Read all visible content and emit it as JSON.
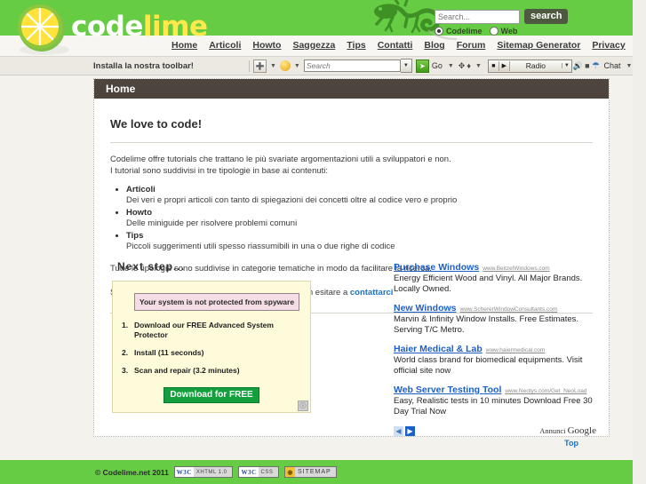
{
  "brand": {
    "code": "code",
    "lime": "lime"
  },
  "search": {
    "placeholder": "Search...",
    "value": "",
    "button": "search",
    "scope_site": "Codelime",
    "scope_web": "Web"
  },
  "nav": {
    "items": [
      {
        "label": "Home"
      },
      {
        "label": "Articoli"
      },
      {
        "label": "Howto"
      },
      {
        "label": "Saggezza"
      },
      {
        "label": "Tips"
      },
      {
        "label": "Contatti"
      },
      {
        "label": "Blog"
      },
      {
        "label": "Forum"
      },
      {
        "label": "Sitemap Generator"
      },
      {
        "label": "Privacy"
      }
    ]
  },
  "toolbar": {
    "label": "Installa la nostra toolbar!",
    "search_placeholder": "Search",
    "go_label": "Go",
    "radio_label": "Radio",
    "chat_label": "Chat"
  },
  "card": {
    "header": "Home",
    "title": "We love to code!",
    "intro_line1": "Codelime offre tutorials che trattano le più svariate argomentazioni utili a sviluppatori e non.",
    "intro_line2": "I tutorial sono suddivisi in tre tipologie in base ai contenuti:",
    "types": [
      {
        "name": "Articoli",
        "desc": "Dei veri e propri articoli con tanto di spiegazioni dei concetti oltre al codice vero e proprio"
      },
      {
        "name": "Howto",
        "desc": "Delle miniguide per risolvere problemi comuni"
      },
      {
        "name": "Tips",
        "desc": "Piccoli suggerimenti utili spesso riassumibili in una o due righe di codice"
      }
    ],
    "outro": "Tutte le tipologie sono suddivise in categorie tematiche in modo da facilitare la ricerca.",
    "contribute_prefix": "Se vuoi contribuire scrivendo anche tu delle guide non esitare a ",
    "contribute_link": "contattarci"
  },
  "promo": {
    "heading": "Next step...",
    "warning": "Your system is not protected from spyware",
    "steps": [
      {
        "num": "1.",
        "text": "Download our FREE Advanced System Protector"
      },
      {
        "num": "2.",
        "text": "Install (11 seconds)"
      },
      {
        "num": "3.",
        "text": "Scan and repair (3.2 minutes)"
      }
    ],
    "cta": "Download for FREE",
    "corner_icon": "info-icon"
  },
  "ads": {
    "items": [
      {
        "title": "Purchase Windows",
        "url": "www.BeitzelWindows.com",
        "desc": "Energy Efficient Wood and Vinyl. All Major Brands. Locally Owned."
      },
      {
        "title": "New Windows",
        "url": "www.SchererWindowConsultants.com",
        "desc": "Marvin & Infinity Window Installs. Free Estimates. Serving T/C Metro."
      },
      {
        "title": "Haier Medical & Lab",
        "url": "www.haiermedical.com",
        "desc": "World class brand for biomedical equipments. Visit official site now"
      },
      {
        "title": "Web Server Testing Tool",
        "url": "www.Neotys.com/Get_NeoLoad",
        "desc": "Easy, Realistic tests in 10 minutes Download Free 30 Day Trial Now"
      }
    ],
    "prev": "◀",
    "next": "▶",
    "brand_prefix": "Annunci ",
    "brand_name": "Google",
    "top_link": "Top"
  },
  "footer": {
    "copyright": "© Codelime.net 2011",
    "badges": [
      {
        "left": "W3C",
        "right": "XHTML 1.0"
      },
      {
        "left": "W3C",
        "right": "CSS"
      },
      {
        "left": "◉",
        "right": "SITEMAP"
      }
    ]
  },
  "colors": {
    "green": "#66cc44",
    "dark_header": "#4e443e",
    "link_blue": "#1b72c4",
    "ad_yellow": "#fdfbd9"
  }
}
